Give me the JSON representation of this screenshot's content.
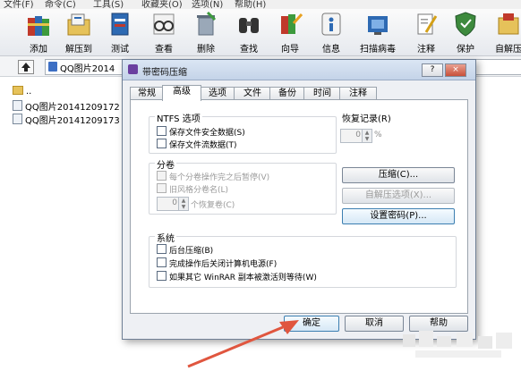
{
  "menubar": {
    "items": [
      "文件(F)",
      "命令(C)",
      "工具(S)",
      "收藏夹(O)",
      "选项(N)",
      "帮助(H)"
    ]
  },
  "toolbar": {
    "buttons": [
      {
        "label": "添加",
        "icon": "add-books-icon"
      },
      {
        "label": "解压到",
        "icon": "extract-folder-icon"
      },
      {
        "label": "测试",
        "icon": "test-book-icon"
      },
      {
        "label": "查看",
        "icon": "view-glasses-icon"
      },
      {
        "label": "删除",
        "icon": "delete-icon"
      },
      {
        "label": "查找",
        "icon": "find-binoculars-icon"
      },
      {
        "label": "向导",
        "icon": "wizard-icon"
      },
      {
        "label": "信息",
        "icon": "info-icon"
      },
      {
        "label": "扫描病毒",
        "icon": "scan-virus-icon"
      },
      {
        "label": "注释",
        "icon": "comment-icon"
      },
      {
        "label": "保护",
        "icon": "protect-shield-icon"
      },
      {
        "label": "自解压",
        "icon": "sfx-icon"
      }
    ]
  },
  "address": {
    "path": "QQ图片2014"
  },
  "files": [
    {
      "name": "..",
      "type": "folder"
    },
    {
      "name": "QQ图片20141209172",
      "type": "image"
    },
    {
      "name": "QQ图片20141209173",
      "type": "image"
    }
  ],
  "dialog": {
    "title": "带密码压缩",
    "help_btn": "?",
    "close_btn": "×",
    "tabs": [
      "常规",
      "高级",
      "选项",
      "文件",
      "备份",
      "时间",
      "注释"
    ],
    "active_tab": 1,
    "ntfs": {
      "title": "NTFS 选项",
      "options": [
        "保存文件安全数据(S)",
        "保存文件流数据(T)"
      ]
    },
    "recovery": {
      "title": "恢复记录(R)",
      "value": "0",
      "unit": "%"
    },
    "volumes": {
      "title": "分卷",
      "options": [
        "每个分卷操作完之后暂停(V)",
        "旧风格分卷名(L)"
      ],
      "spin_value": "0",
      "spin_label": "个恢复卷(C)"
    },
    "buttons": {
      "compress": "压缩(C)...",
      "sfx_options": "自解压选项(X)...",
      "set_password": "设置密码(P)..."
    },
    "system": {
      "title": "系统",
      "options": [
        "后台压缩(B)",
        "完成操作后关闭计算机电源(F)",
        "如果其它 WinRAR 副本被激活则等待(W)"
      ]
    },
    "footer": {
      "ok": "确定",
      "cancel": "取消",
      "help": "帮助"
    }
  },
  "colors": {
    "arrow": "#e0563f",
    "title_bar": "#c4d3e8"
  }
}
